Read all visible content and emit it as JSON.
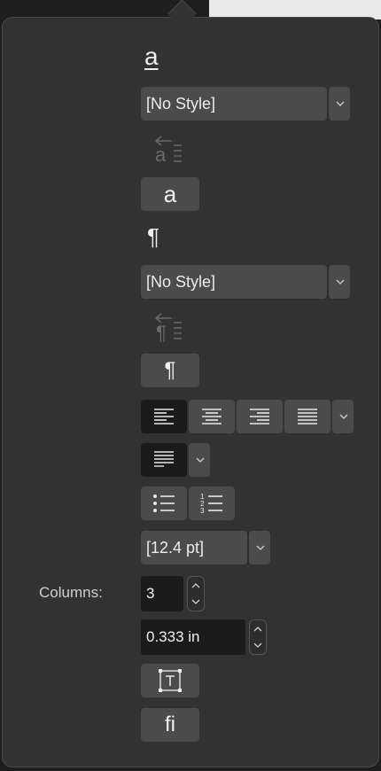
{
  "character_style": {
    "icon_glyph": "a",
    "dropdown_value": "[No Style]",
    "button_glyph": "a"
  },
  "paragraph_style": {
    "icon_glyph": "¶",
    "dropdown_value": "[No Style]",
    "button_glyph": "¶"
  },
  "alignment": {
    "options": [
      "align-left",
      "align-center",
      "align-right",
      "justify"
    ],
    "selected": "align-left"
  },
  "leading": {
    "value": "[12.4 pt]"
  },
  "columns": {
    "label": "Columns:",
    "count": "3",
    "gutter": "0.333 in"
  },
  "ligature_button": {
    "glyph": "fi"
  },
  "colors": {
    "panel": "#323232",
    "control": "#4b4b4b",
    "selected": "#1b1b1b"
  }
}
